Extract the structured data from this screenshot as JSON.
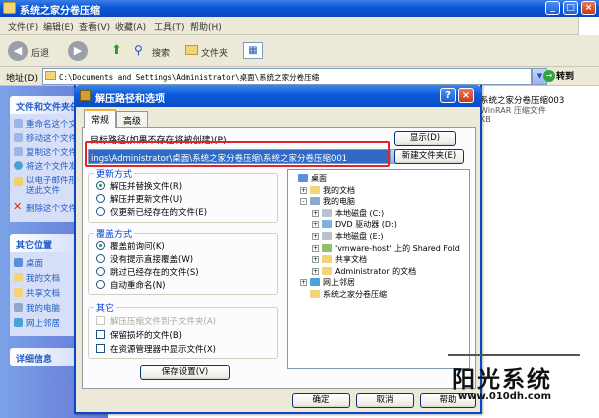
{
  "window": {
    "title": "系统之家分卷压缩",
    "menu": [
      "文件(F)",
      "编辑(E)",
      "查看(V)",
      "收藏(A)",
      "工具(T)",
      "帮助(H)"
    ],
    "toolbar": {
      "back": "后退",
      "search": "搜索",
      "folders": "文件夹"
    },
    "address": {
      "label": "地址(D)",
      "value": "C:\\Documents and Settings\\Administrator\\桌面\\系统之家分卷压缩",
      "go": "转到"
    }
  },
  "taskpane": {
    "file_tasks_title": "文件和文件夹任务",
    "file_tasks": [
      "重命名这个文件",
      "移动这个文件",
      "复制这个文件",
      "将这个文件发布到 Web",
      "以电子邮件形式发送此文件",
      "删除这个文件"
    ],
    "other_places_title": "其它位置",
    "other_places": [
      "桌面",
      "我的文档",
      "共享文档",
      "我的电脑",
      "网上邻居"
    ],
    "details_title": "详细信息"
  },
  "content": {
    "file_name": "系统之家分卷压缩003",
    "file_type": "WinRAR 压缩文件",
    "file_size": "KB"
  },
  "dialog": {
    "title": "解压路径和选项",
    "tabs": [
      "常规",
      "高级"
    ],
    "path_label": "目标路径(如果不存在将被创建)(P)",
    "path_value": "ings\\Administrator\\桌面\\系统之家分卷压缩\\系统之家分卷压缩001",
    "show_button": "显示(D)",
    "new_folder_button": "新建文件夹(E)",
    "update_group": {
      "title": "更新方式",
      "options": [
        "解压并替换文件(R)",
        "解压并更新文件(U)",
        "仅更新已经存在的文件(E)"
      ],
      "selected": 0
    },
    "overwrite_group": {
      "title": "覆盖方式",
      "options": [
        "覆盖前询问(K)",
        "没有提示直接覆盖(W)",
        "跳过已经存在的文件(S)",
        "自动重命名(N)"
      ],
      "selected": 0
    },
    "misc_group": {
      "title": "其它",
      "options": [
        "解压压缩文件到子文件夹(A)",
        "保留损坏的文件(B)",
        "在资源管理器中显示文件(X)"
      ]
    },
    "save_button": "保存设置(V)",
    "tree": [
      {
        "label": "桌面",
        "level": 0,
        "sign": ""
      },
      {
        "label": "我的文档",
        "level": 1,
        "sign": "+"
      },
      {
        "label": "我的电脑",
        "level": 1,
        "sign": "-"
      },
      {
        "label": "本地磁盘 (C:)",
        "level": 2,
        "sign": "+"
      },
      {
        "label": "DVD 驱动器 (D:)",
        "level": 2,
        "sign": "+"
      },
      {
        "label": "本地磁盘 (E:)",
        "level": 2,
        "sign": "+"
      },
      {
        "label": "'vmware-host' 上的 Shared Fold",
        "level": 2,
        "sign": "+"
      },
      {
        "label": "共享文档",
        "level": 2,
        "sign": "+"
      },
      {
        "label": "Administrator 的文档",
        "level": 2,
        "sign": "+"
      },
      {
        "label": "网上邻居",
        "level": 1,
        "sign": "+"
      },
      {
        "label": "系统之家分卷压缩",
        "level": 1,
        "sign": ""
      }
    ],
    "ok_button": "确定",
    "cancel_button": "取消",
    "help_button": "帮助"
  },
  "watermark": {
    "title": "阳光系统",
    "url": "www.010dh.com"
  },
  "colors": {
    "xp_blue": "#0a58d4",
    "highlight": "#316ac5",
    "red_frame": "#e3242b",
    "task_pane": "#6f8ee0"
  }
}
